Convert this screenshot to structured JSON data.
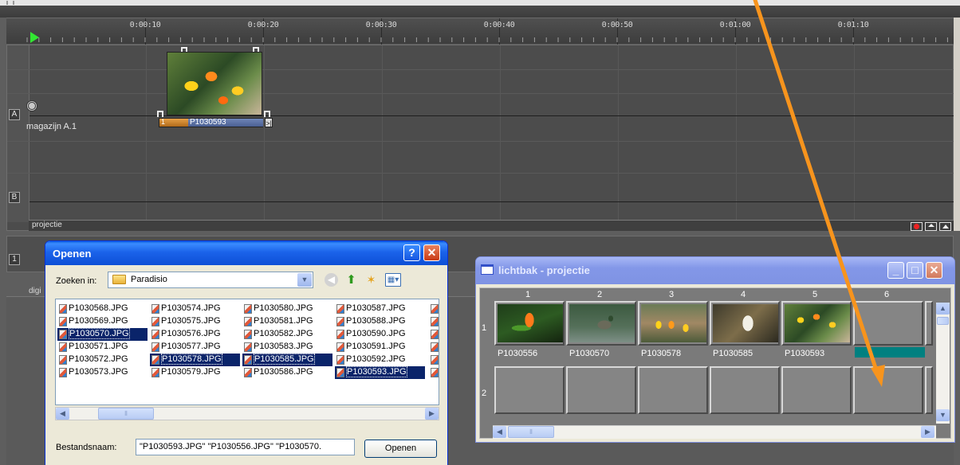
{
  "timeline": {
    "ruler_labels": [
      "0:00:10",
      "0:00:20",
      "0:00:30",
      "0:00:40",
      "0:00:50",
      "0:01:00",
      "0:01:10"
    ],
    "track_a_letter": "A",
    "track_b_letter": "B",
    "track_1_letter": "1",
    "track_name": "magazijn A.1",
    "clip_name": "P1030593",
    "clip_number": "1",
    "clip_end_glyph": ">|",
    "projection_label": "projectie",
    "digi_label": "digi"
  },
  "dialog": {
    "title": "Openen",
    "help_glyph": "?",
    "close_glyph": "✕",
    "look_in_label": "Zoeken in:",
    "look_in_value": "Paradisio",
    "files_col1": [
      "P1030568.JPG",
      "P1030569.JPG",
      "P1030570.JPG",
      "P1030571.JPG",
      "P1030572.JPG",
      "P1030573.JPG"
    ],
    "files_col2": [
      "P1030574.JPG",
      "P1030575.JPG",
      "P1030576.JPG",
      "P1030577.JPG",
      "P1030578.JPG",
      "P1030579.JPG"
    ],
    "files_col3": [
      "P1030580.JPG",
      "P1030581.JPG",
      "P1030582.JPG",
      "P1030583.JPG",
      "P1030585.JPG",
      "P1030586.JPG"
    ],
    "files_col4": [
      "P1030587.JPG",
      "P1030588.JPG",
      "P1030590.JPG",
      "P1030591.JPG",
      "P1030592.JPG",
      "P1030593.JPG"
    ],
    "selected_files": [
      "P1030570.JPG",
      "P1030578.JPG",
      "P1030585.JPG",
      "P1030593.JPG"
    ],
    "filename_label": "Bestandsnaam:",
    "filename_value": "\"P1030593.JPG\" \"P1030556.JPG\" \"P1030570.",
    "open_button": "Openen"
  },
  "lightbox": {
    "title": "lichtbak - projectie",
    "columns": [
      "1",
      "2",
      "3",
      "4",
      "5",
      "6"
    ],
    "rows": [
      "1",
      "2"
    ],
    "thumbnails": [
      "P1030556",
      "P1030570",
      "P1030578",
      "P1030585",
      "P1030593"
    ]
  },
  "colors": {
    "annotation_arrow": "#f7941d",
    "selection": "#0a246a",
    "selected_cell": "#008080"
  }
}
